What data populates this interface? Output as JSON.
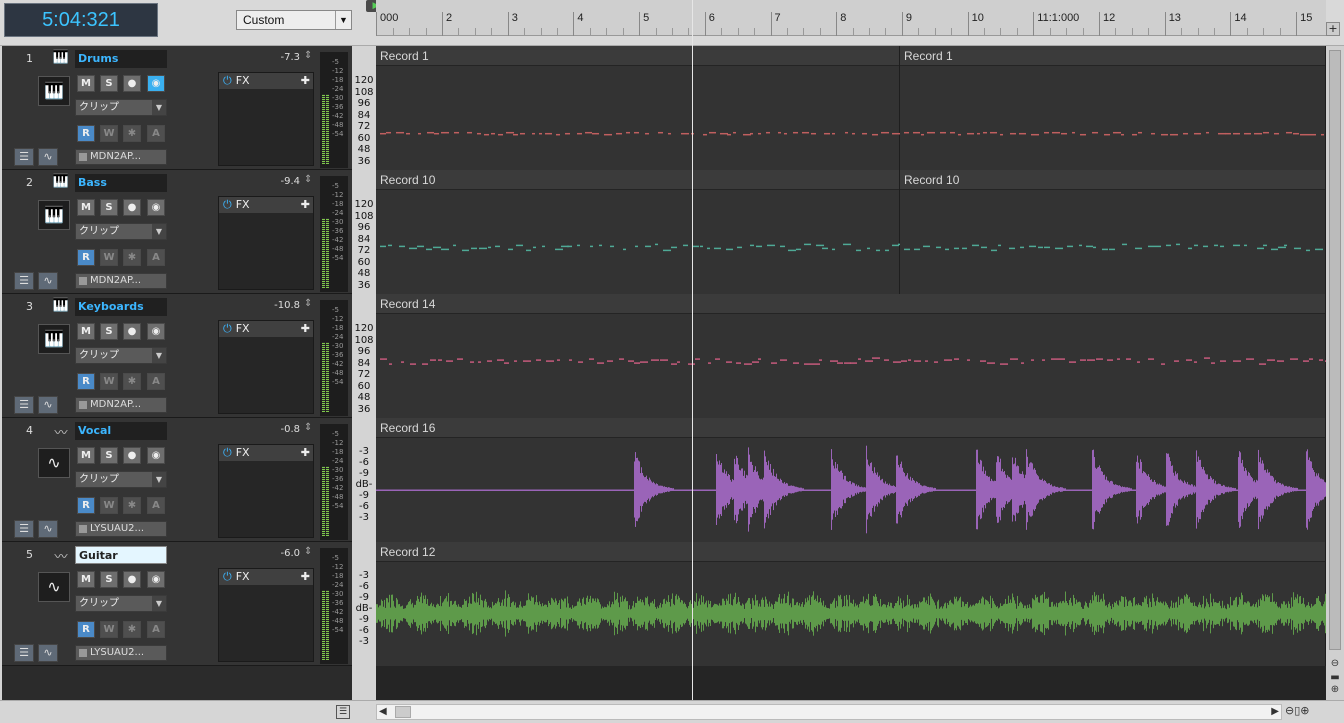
{
  "transport": {
    "timecode": "5:04:321"
  },
  "preset": {
    "value": "Custom"
  },
  "ruler": {
    "start_label": "000",
    "bars": [
      "2",
      "3",
      "4",
      "5",
      "6",
      "7",
      "8",
      "9",
      "10",
      "11:1:000",
      "12",
      "13",
      "14",
      "15"
    ]
  },
  "tracks": [
    {
      "num": "1",
      "name": "Drums",
      "volume": "-7.3",
      "type": "midi",
      "clip_mode": "クリップ",
      "input": "MDN2AP...",
      "fx": "FX",
      "btn_m": "M",
      "btn_s": "S",
      "btn_r": "R",
      "btn_w": "W",
      "btn_a": "A",
      "scale": [
        "120",
        "108",
        "96",
        "84",
        "72",
        "60",
        "48",
        "36"
      ],
      "selected": false,
      "icon": "piano-icon"
    },
    {
      "num": "2",
      "name": "Bass",
      "volume": "-9.4",
      "type": "midi",
      "clip_mode": "クリップ",
      "input": "MDN2AP...",
      "fx": "FX",
      "btn_m": "M",
      "btn_s": "S",
      "btn_r": "R",
      "btn_w": "W",
      "btn_a": "A",
      "scale": [
        "120",
        "108",
        "96",
        "84",
        "72",
        "60",
        "48",
        "36"
      ],
      "selected": false,
      "icon": "piano-icon"
    },
    {
      "num": "3",
      "name": "Keyboards",
      "volume": "-10.8",
      "type": "midi",
      "clip_mode": "クリップ",
      "input": "MDN2AP...",
      "fx": "FX",
      "btn_m": "M",
      "btn_s": "S",
      "btn_r": "R",
      "btn_w": "W",
      "btn_a": "A",
      "scale": [
        "120",
        "108",
        "96",
        "84",
        "72",
        "60",
        "48",
        "36"
      ],
      "selected": false,
      "icon": "piano-icon"
    },
    {
      "num": "4",
      "name": "Vocal",
      "volume": "-0.8",
      "type": "audio",
      "clip_mode": "クリップ",
      "input": "LYSUAU2...",
      "fx": "FX",
      "btn_m": "M",
      "btn_s": "S",
      "btn_r": "R",
      "btn_w": "W",
      "btn_a": "A",
      "scale": [
        "-3",
        "-6",
        "-9",
        "dB-",
        "-9",
        "-6",
        "-3"
      ],
      "selected": false,
      "icon": "waveform-icon"
    },
    {
      "num": "5",
      "name": "Guitar",
      "volume": "-6.0",
      "type": "audio",
      "clip_mode": "クリップ",
      "input": "LYSUAU2...",
      "fx": "FX",
      "btn_m": "M",
      "btn_s": "S",
      "btn_r": "R",
      "btn_w": "W",
      "btn_a": "A",
      "scale": [
        "-3",
        "-6",
        "-9",
        "dB-",
        "-9",
        "-6",
        "-3"
      ],
      "selected": true,
      "icon": "waveform-icon"
    }
  ],
  "meter_scale": [
    "-5",
    "-12",
    "-18",
    "-24",
    "-30",
    "-36",
    "-42",
    "-48",
    "-54"
  ],
  "lanes": [
    {
      "clips": [
        {
          "name": "Record 1",
          "start": 0,
          "end": 524,
          "flag": true
        },
        {
          "name": "Record 1",
          "start": 524,
          "end": 950,
          "flag": true
        }
      ],
      "color": "#c05f5f",
      "kind": "midi",
      "level": 0.65
    },
    {
      "clips": [
        {
          "name": "Record 10",
          "start": 0,
          "end": 524,
          "flag": true
        },
        {
          "name": "Record 10",
          "start": 524,
          "end": 950,
          "flag": true
        }
      ],
      "color": "#4faa96",
      "kind": "midi",
      "level": 0.55
    },
    {
      "clips": [
        {
          "name": "Record 14",
          "start": 0,
          "end": 950,
          "flag": true
        }
      ],
      "color": "#c55a7c",
      "kind": "midi",
      "level": 0.45
    },
    {
      "clips": [
        {
          "name": "Record 16",
          "start": 0,
          "end": 950,
          "flag": false
        }
      ],
      "color": "#9a64b8",
      "kind": "vocal",
      "level": 0.5
    },
    {
      "clips": [
        {
          "name": "Record 12",
          "start": 0,
          "end": 950,
          "flag": false
        }
      ],
      "color": "#5e9a4a",
      "kind": "guitar",
      "level": 0.5
    }
  ]
}
